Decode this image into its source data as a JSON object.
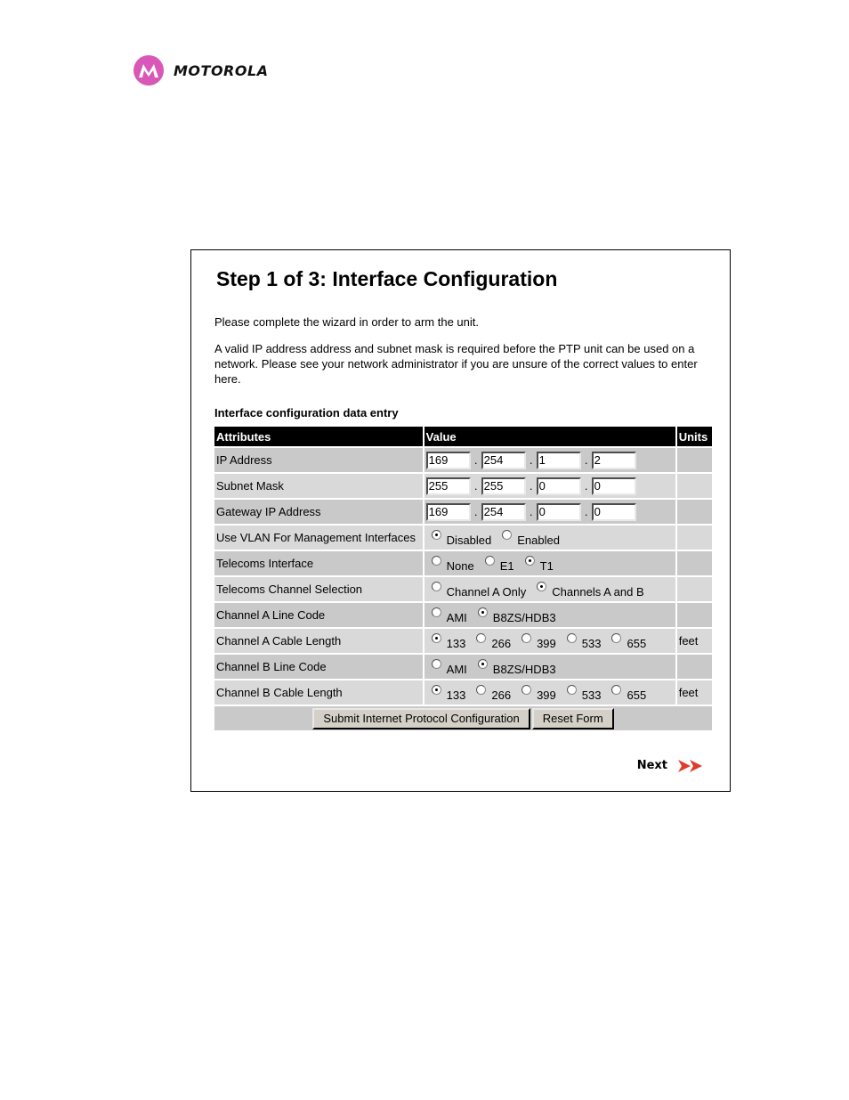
{
  "brand": {
    "name": "MOTOROLA",
    "logo_color": "#d957b6",
    "icon": "motorola-batwing-icon"
  },
  "page": {
    "title": "Step 1 of 3: Interface Configuration",
    "intro": "Please complete the wizard in order to arm the unit.",
    "description": "A valid IP address address and subnet mask is required before the PTP unit can be used on a network. Please see your network administrator if you are unsure of the correct values to enter here.",
    "section_title": "Interface configuration data entry"
  },
  "table": {
    "headers": {
      "attributes": "Attributes",
      "value": "Value",
      "units": "Units"
    },
    "ip_rows": [
      {
        "label": "IP Address",
        "octets": [
          "169",
          "254",
          "1",
          "2"
        ],
        "units": ""
      },
      {
        "label": "Subnet Mask",
        "octets": [
          "255",
          "255",
          "0",
          "0"
        ],
        "units": ""
      },
      {
        "label": "Gateway IP Address",
        "octets": [
          "169",
          "254",
          "0",
          "0"
        ],
        "units": ""
      }
    ],
    "separator": ".",
    "radio_rows": [
      {
        "label": "Use VLAN For Management Interfaces",
        "options": [
          "Disabled",
          "Enabled"
        ],
        "selected": "Disabled",
        "units": ""
      },
      {
        "label": "Telecoms Interface",
        "options": [
          "None",
          "E1",
          "T1"
        ],
        "selected": "T1",
        "units": ""
      },
      {
        "label": "Telecoms Channel Selection",
        "options": [
          "Channel A Only",
          "Channels A and B"
        ],
        "selected": "Channels A and B",
        "units": ""
      },
      {
        "label": "Channel A Line Code",
        "options": [
          "AMI",
          "B8ZS/HDB3"
        ],
        "selected": "B8ZS/HDB3",
        "units": ""
      },
      {
        "label": "Channel A Cable Length",
        "options": [
          "133",
          "266",
          "399",
          "533",
          "655"
        ],
        "selected": "133",
        "units": "feet"
      },
      {
        "label": "Channel B Line Code",
        "options": [
          "AMI",
          "B8ZS/HDB3"
        ],
        "selected": "B8ZS/HDB3",
        "units": ""
      },
      {
        "label": "Channel B Cable Length",
        "options": [
          "133",
          "266",
          "399",
          "533",
          "655"
        ],
        "selected": "133",
        "units": "feet"
      }
    ]
  },
  "buttons": {
    "submit": "Submit Internet Protocol Configuration",
    "reset": "Reset Form"
  },
  "nav": {
    "next_label": "Next",
    "next_icon": "double-chevron-right-icon",
    "next_icon_color": "#e03a2a"
  }
}
